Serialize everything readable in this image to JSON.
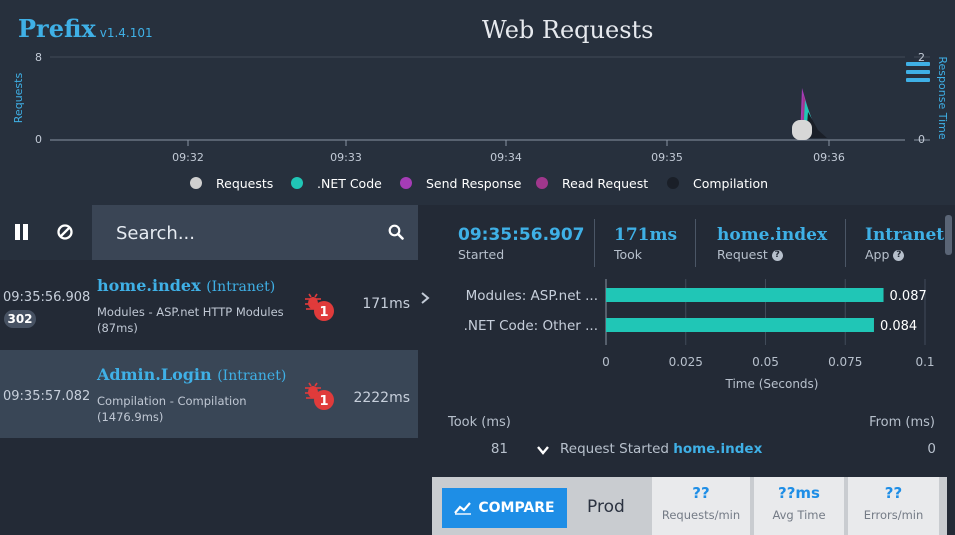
{
  "app": {
    "name": "Prefix",
    "version": "v1.4.101",
    "title": "Web Requests"
  },
  "colors": {
    "accent": "#3fb0e6",
    "teal": "#20c6b6",
    "purple": "#a53cb6",
    "magenta": "#a0378c",
    "dark": "#1a1f28",
    "badge_red": "#e03b3b"
  },
  "chart_data": {
    "type": "line",
    "x_ticks": [
      "09:32",
      "09:33",
      "09:34",
      "09:35",
      "09:36"
    ],
    "y_left": {
      "label": "Requests",
      "ticks": [
        "8",
        "0"
      ],
      "ylim": [
        0,
        8
      ]
    },
    "y_right": {
      "label": "Response Time",
      "ticks": [
        "2",
        "0"
      ],
      "ylim": [
        0,
        2
      ]
    },
    "legend": [
      "Requests",
      ".NET Code",
      "Send Response",
      "Read Request",
      "Compilation"
    ],
    "legend_position": "bottom"
  },
  "toolbar": {
    "search_placeholder": "Search..."
  },
  "requests": [
    {
      "time": "09:35:56.908",
      "name": "home.index",
      "app": "(Intranet)",
      "detail": "Modules - ASP.net HTTP Modules (87ms)",
      "status": "302",
      "errors": "1",
      "duration": "171ms"
    },
    {
      "time": "09:35:57.082",
      "name": "Admin.Login",
      "app": "(Intranet)",
      "detail": "Compilation - Compilation (1476.9ms)",
      "errors": "1",
      "duration": "2222ms"
    }
  ],
  "summary": {
    "started": {
      "value": "09:35:56.907",
      "label": "Started"
    },
    "took": {
      "value": "171ms",
      "label": "Took"
    },
    "request": {
      "value": "home.index",
      "label": "Request"
    },
    "app": {
      "value": "Intranet",
      "label": "App"
    }
  },
  "timing_chart": {
    "type": "bar",
    "categories": [
      "Modules: ASP.net ...",
      ".NET Code: Other ..."
    ],
    "values": [
      0.087,
      0.084
    ],
    "value_labels": [
      "0.087",
      "0.084"
    ],
    "x_ticks": [
      "0",
      "0.025",
      "0.05",
      "0.075",
      "0.1"
    ],
    "xlim": [
      0,
      0.1
    ],
    "xlabel": "Time (Seconds)"
  },
  "timeline": {
    "took_header": "Took (ms)",
    "from_header": "From (ms)",
    "rows": [
      {
        "took": "81",
        "label": "Request Started",
        "name": "home.index",
        "from": "0"
      }
    ]
  },
  "bottom": {
    "compare_label": "COMPARE",
    "env": "Prod",
    "metrics": [
      {
        "value": "??",
        "label": "Requests/min"
      },
      {
        "value": "??ms",
        "label": "Avg Time"
      },
      {
        "value": "??",
        "label": "Errors/min"
      }
    ]
  }
}
